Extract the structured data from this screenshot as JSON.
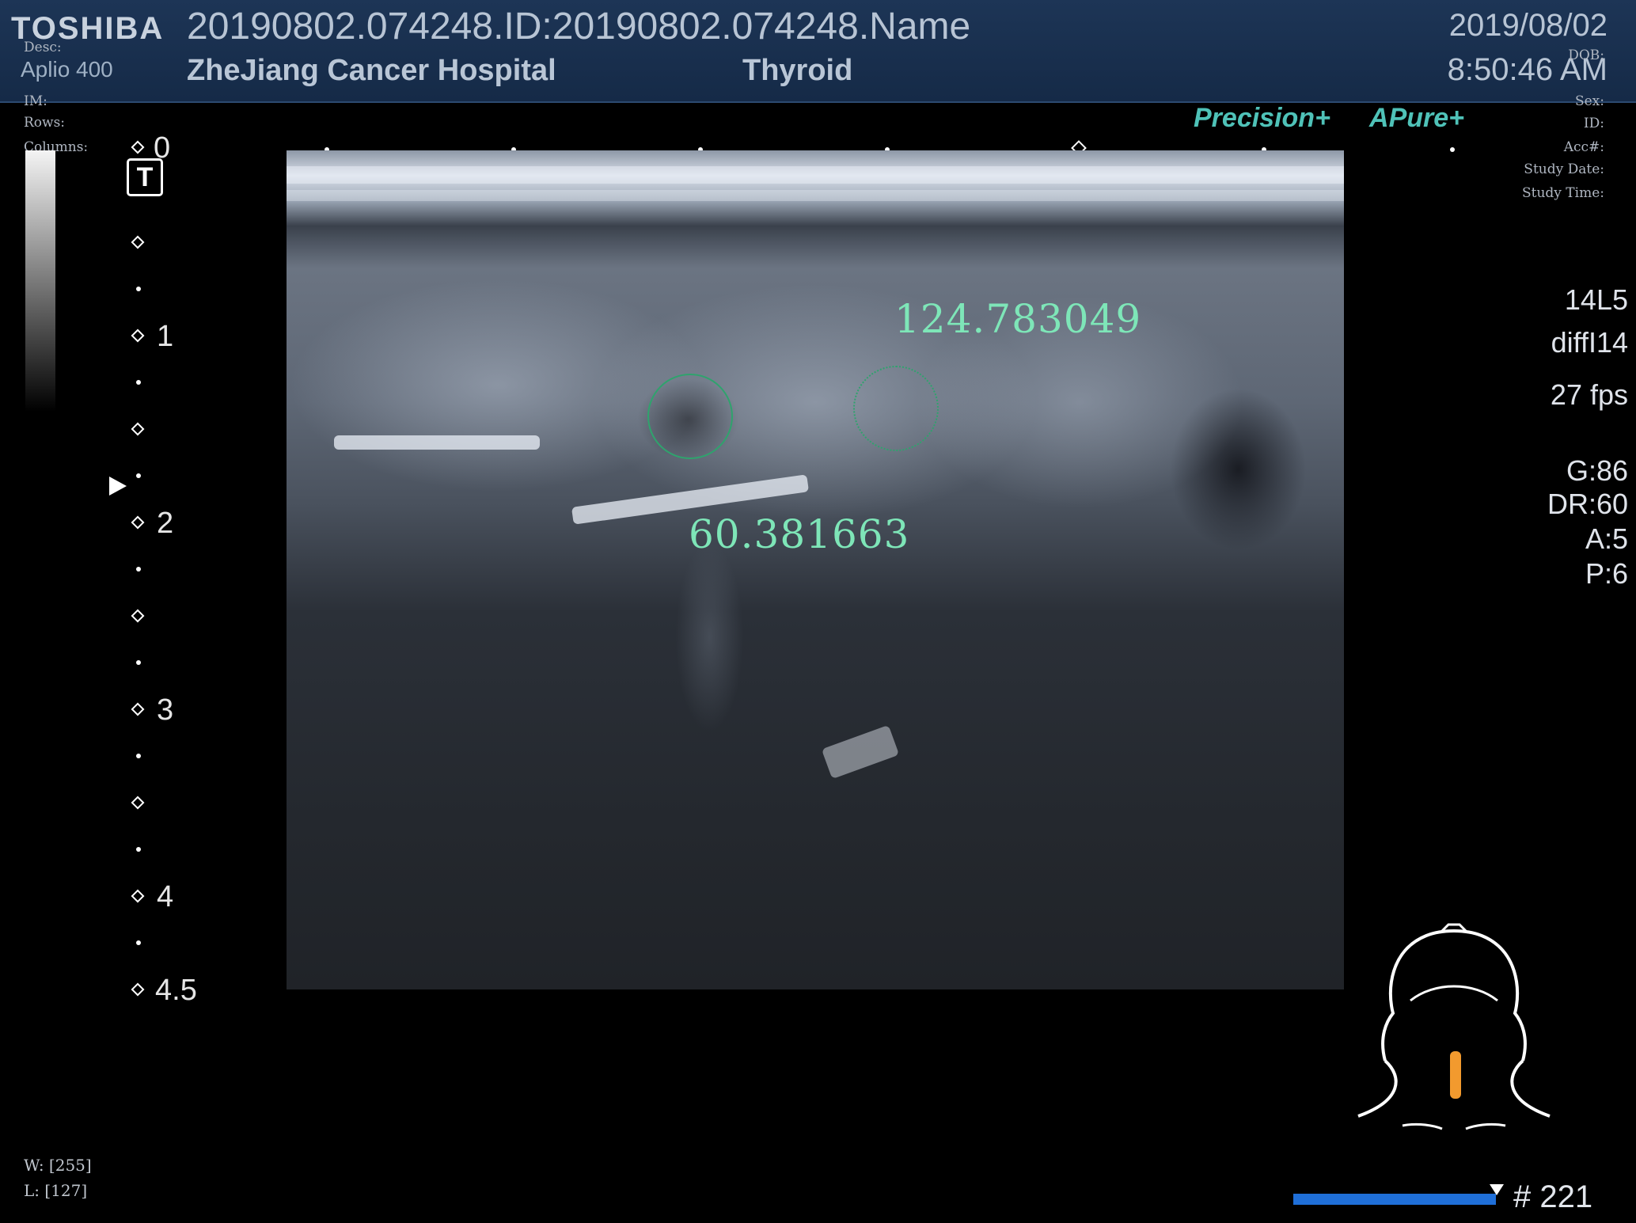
{
  "header": {
    "brand": "TOSHIBA",
    "system": "Aplio 400",
    "study_id": "20190802.074248.ID:20190802.074248.Name",
    "institution": "ZheJiang Cancer Hospital",
    "preset": "Thyroid",
    "date": "2019/08/02",
    "time": "8:50:46 AM"
  },
  "dicom_overlay_left": [
    "Desc:",
    "IM:",
    "Rows:",
    "Columns:"
  ],
  "dicom_overlay_right": [
    "DOB:",
    "Sex:",
    "ID:",
    "Acc#:",
    "Study Date:",
    "Study Time:"
  ],
  "image_logos": {
    "precision": "Precision+",
    "pure": "Pure+"
  },
  "depth_scale": {
    "unit_labels": [
      "0",
      "1",
      "2",
      "3",
      "4",
      "4.5"
    ],
    "t_marker": "T"
  },
  "roi": [
    {
      "value": "124.783049"
    },
    {
      "value": "60.381663"
    }
  ],
  "params": {
    "probe": "14L5",
    "mode": "diffI14",
    "fps": "27 fps",
    "gain": "G:86",
    "dynamic_range": "DR:60",
    "a": "A:5",
    "p": "P:6"
  },
  "window": {
    "width": "W: [255]",
    "level": "L: [127]"
  },
  "cine": {
    "frame": "# 221",
    "progress": 1.0
  },
  "colors": {
    "roi": "#2fa36d",
    "roi_text": "#7ee6b8",
    "accent_logo": "#4fc2b8",
    "cine_bar": "#1f6fd8",
    "probe_mark": "#f29a2e"
  },
  "icons": [
    "body-mark-head-neck-icon",
    "focus-arrow-icon"
  ]
}
